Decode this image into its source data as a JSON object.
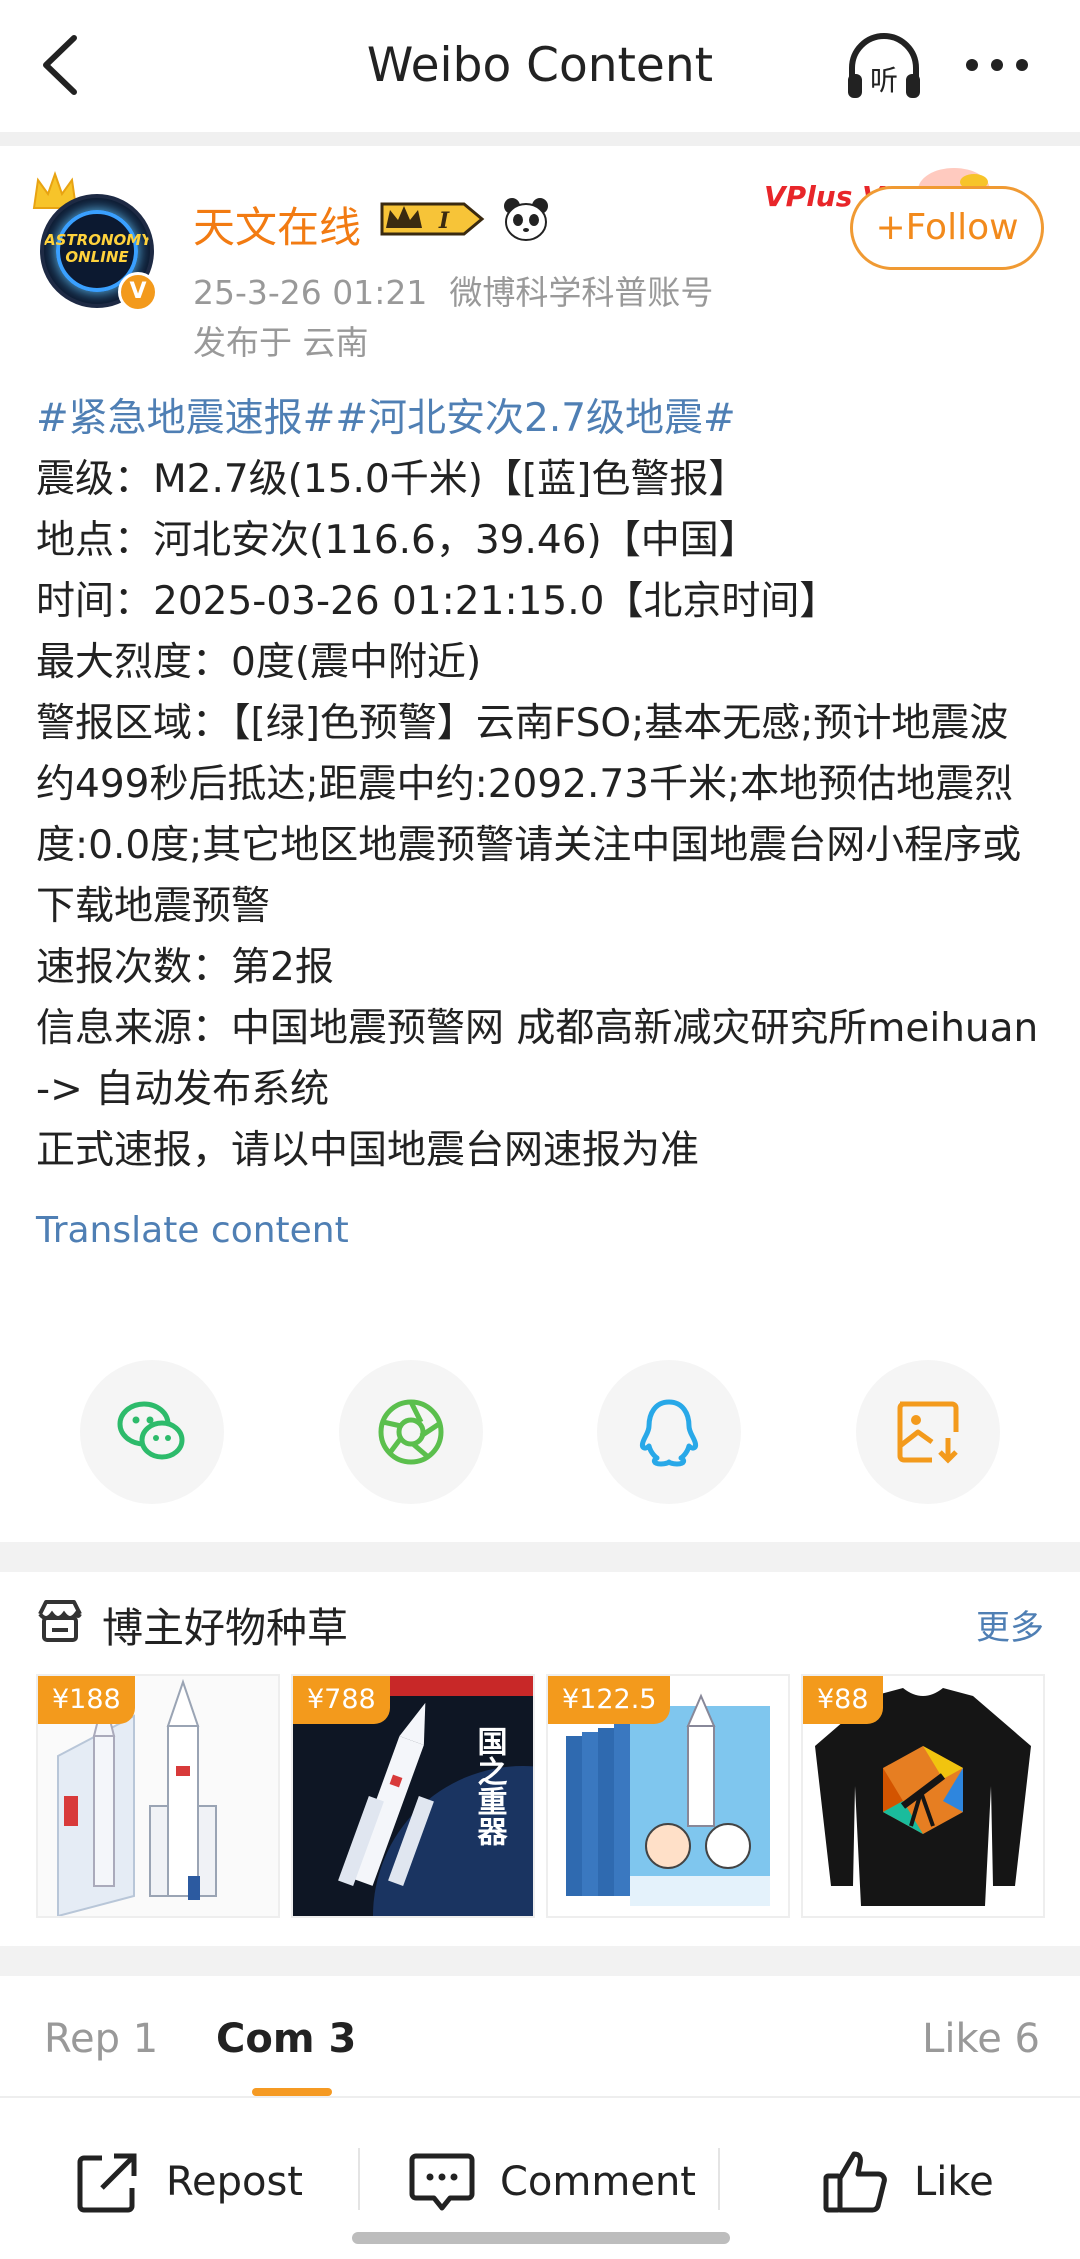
{
  "header": {
    "title": "Weibo Content",
    "back_icon": "back-arrow-icon",
    "listen_icon": "headphones-listen-icon",
    "listen_label": "听",
    "more_icon": "more-dots-icon"
  },
  "author": {
    "name": "天文在线",
    "rank_badge": "I",
    "avatar_text": "ASTRONOMY ONLINE",
    "verified_mark": "V",
    "date": "25-3-26 01:21",
    "account_type": "微博科学科普账号",
    "location": "发布于 云南",
    "vplus_label": "VPlus V",
    "follow_label": "+Follow"
  },
  "post": {
    "hashtags": "#紧急地震速报##河北安次2.7级地震#",
    "lines": [
      "震级：M2.7级(15.0千米)【[蓝]色警报】",
      "地点：河北安次(116.6，39.46)【中国】",
      "时间：2025-03-26 01:21:15.0【北京时间】",
      "最大烈度：0度(震中附近)",
      "警报区域：【[绿]色预警】云南FSO;基本无感;预计地震波约499秒后抵达;距震中约:2092.73千米;本地预估地震烈度:0.0度;其它地区地震预警请关注中国地震台网小程序或下载地震预警",
      "速报次数：第2报",
      "信息来源：中国地震预警网  成都高新减灾研究所meihuan -> 自动发布系统",
      "正式速报，请以中国地震台网速报为准"
    ],
    "translate": "Translate content"
  },
  "share": [
    {
      "name": "wechat",
      "icon": "wechat-icon",
      "color": "#2dbb6b"
    },
    {
      "name": "moments",
      "icon": "moments-aperture-icon",
      "color": "#5bbf4d"
    },
    {
      "name": "qq",
      "icon": "qq-penguin-icon",
      "color": "#28a8e8"
    },
    {
      "name": "save-image",
      "icon": "save-image-icon",
      "color": "#f39a1c"
    }
  ],
  "goods": {
    "title": "博主好物种草",
    "more": "更多",
    "items": [
      {
        "price": "¥188",
        "kind": "rocket-lego-set"
      },
      {
        "price": "¥788",
        "kind": "rocket-toy-box",
        "box_text": "国之重器"
      },
      {
        "price": "¥122.5",
        "kind": "space-book-set"
      },
      {
        "price": "¥88",
        "kind": "telescope-sweatshirt"
      }
    ]
  },
  "tabs": {
    "repost": "Rep 1",
    "comment": "Com 3",
    "like": "Like 6",
    "active": "comment"
  },
  "actions": {
    "repost": "Repost",
    "comment": "Comment",
    "like": "Like"
  },
  "colors": {
    "accent": "#f59a23",
    "link": "#4f7fb4",
    "username": "#f27b12"
  }
}
